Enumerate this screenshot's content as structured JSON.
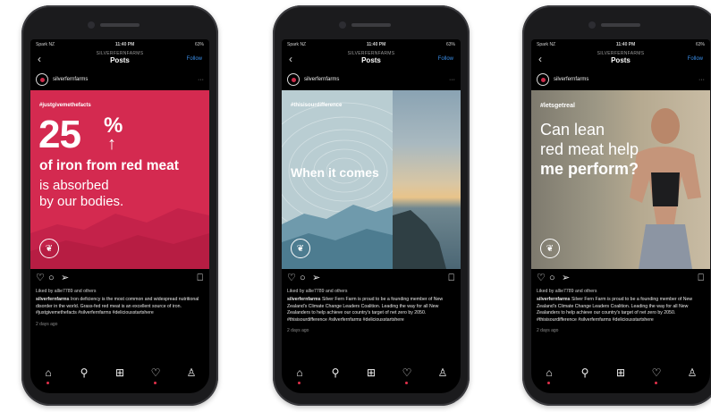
{
  "status": {
    "carrier": "Spark NZ",
    "time": "11:40 PM",
    "battery": "63%"
  },
  "nav": {
    "account_caps": "SILVERFERNFARMS",
    "title": "Posts",
    "follow_label": "Follow"
  },
  "username": "silverfernfarms",
  "liked_by": "Liked by allie7789 and others",
  "time_ago": "2 days ago",
  "icons": {
    "back": "chevron-left-icon",
    "more": "more-dots-icon",
    "like": "heart-icon",
    "comment": "comment-icon",
    "share": "paper-plane-icon",
    "save": "bookmark-icon",
    "tabs": [
      "home-icon",
      "search-icon",
      "add-post-icon",
      "activity-heart-icon",
      "profile-icon"
    ]
  },
  "colors": {
    "accent_red": "#d42a50",
    "follow_blue": "#3a8ee8",
    "background": "#000000"
  },
  "posts": [
    {
      "hashtag": "#justgivemethefacts",
      "headline_number": "25",
      "headline_percent": "%",
      "headline_arrow": "↑",
      "line1": "of iron from red meat",
      "line2": "is absorbed",
      "line3": "by our bodies.",
      "caption_user": "silverfernfarms",
      "caption_text": "Iron deficiency is the most common and widespread nutritional disorder in the world. Grass-fed red meat is an excellent source of iron.",
      "caption_tags": "#justgivemethefacts #silverfernfarms #deliciousstartshere"
    },
    {
      "hashtag": "#thisisourdifference",
      "title": "When it comes",
      "caption_user": "silverfernfarms",
      "caption_text": "Silver Fern Farm is proud to be a founding member of New Zealand's Climate Change Leaders Coalition. Leading the way for all New Zealanders to help achieve our country's target of net zero by 2050.",
      "caption_tags": "#thisisourdifference #silverfernfarms #deliciousstartshere"
    },
    {
      "hashtag": "#letsgetreal",
      "line1": "Can lean",
      "line2": "red meat help",
      "line3": "me perform?",
      "caption_user": "silverfernfarms",
      "caption_text": "Silver Fern Farm is proud to be a founding member of New Zealand's Climate Change Leaders Coalition. Leading the way for all New Zealanders to help achieve our country's target of net zero by 2050.",
      "caption_tags": "#thisisourdifference #silverfernfarms #deliciousstartshere"
    }
  ]
}
